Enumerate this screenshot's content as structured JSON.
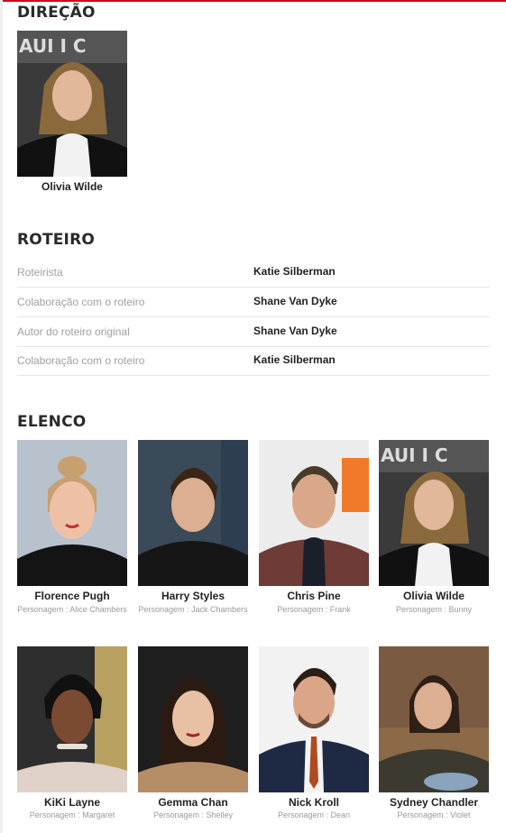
{
  "accent_color": "#d0021b",
  "direcao": {
    "title": "DIREÇÃO",
    "people": [
      {
        "name": "Olivia Wilde"
      }
    ]
  },
  "roteiro": {
    "title": "ROTEIRO",
    "rows": [
      {
        "job": "Roteirista",
        "name": "Katie Silberman"
      },
      {
        "job": "Colaboração com o roteiro",
        "name": "Shane Van Dyke"
      },
      {
        "job": "Autor do roteiro original",
        "name": "Shane Van Dyke"
      },
      {
        "job": "Colaboração com o roteiro",
        "name": "Katie Silberman"
      }
    ]
  },
  "elenco": {
    "title": "ELENCO",
    "role_label": "Personagem :",
    "members": [
      {
        "name": "Florence Pugh",
        "role": "Alice Chambers"
      },
      {
        "name": "Harry Styles",
        "role": "Jack Chambers"
      },
      {
        "name": "Chris Pine",
        "role": "Frank"
      },
      {
        "name": "Olivia Wilde",
        "role": "Bunny"
      },
      {
        "name": "KiKi Layne",
        "role": "Margaret"
      },
      {
        "name": "Gemma Chan",
        "role": "Shelley"
      },
      {
        "name": "Nick Kroll",
        "role": "Dean"
      },
      {
        "name": "Sydney Chandler",
        "role": "Violet"
      }
    ]
  }
}
